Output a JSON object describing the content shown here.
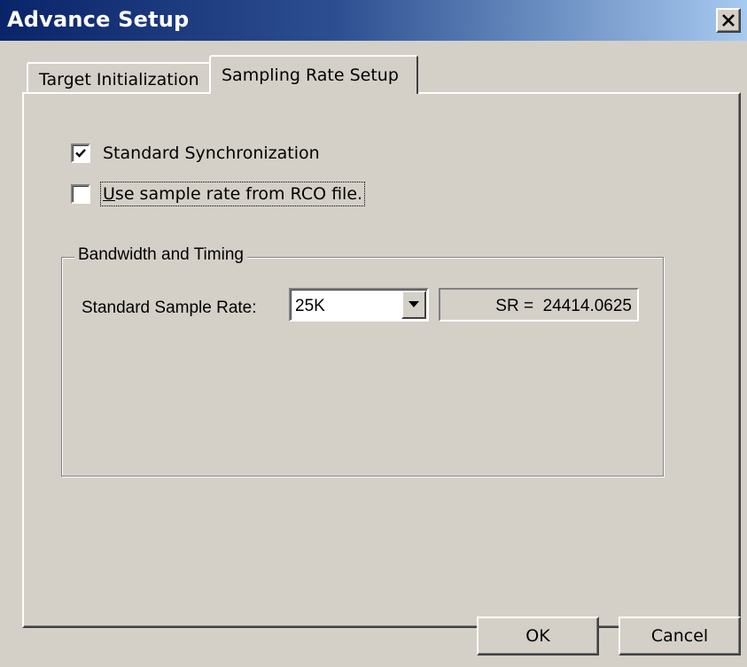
{
  "window": {
    "title": "Advance Setup"
  },
  "tabs": [
    {
      "label": "Target Initialization",
      "selected": false
    },
    {
      "label": "Sampling Rate Setup",
      "selected": true
    }
  ],
  "options": {
    "standard_sync": {
      "label": "Standard Synchronization",
      "checked": true
    },
    "rco_rate": {
      "label_first": "U",
      "label_rest": "se sample rate from RCO file.",
      "checked": false
    }
  },
  "group": {
    "legend": "Bandwidth and Timing",
    "rate_label": "Standard Sample Rate:",
    "rate_value": "25K",
    "sr_readout": "SR =  24414.0625"
  },
  "buttons": {
    "ok": "OK",
    "cancel": "Cancel"
  },
  "icons": {
    "close": "close-icon",
    "checkmark": "checkmark-icon",
    "dropdown": "chevron-down-icon"
  }
}
